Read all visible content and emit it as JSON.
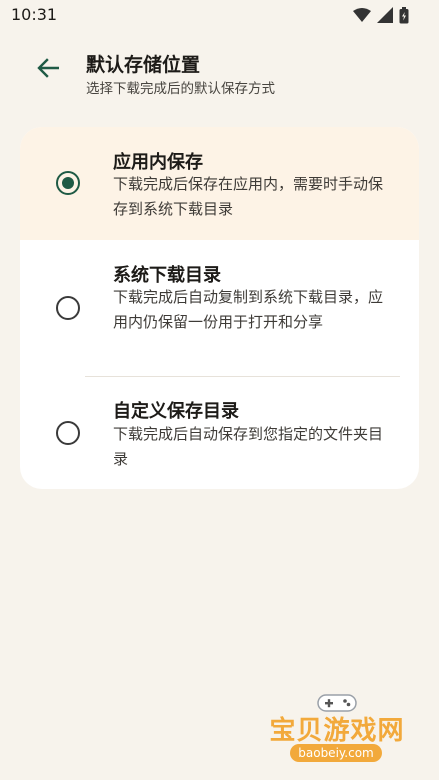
{
  "status_bar": {
    "time": "10:31"
  },
  "header": {
    "title": "默认存储位置",
    "subtitle": "选择下载完成后的默认保存方式"
  },
  "options": [
    {
      "title": "应用内保存",
      "description": "下载完成后保存在应用内，需要时手动保存到系统下载目录",
      "selected": true
    },
    {
      "title": "系统下载目录",
      "description": "下载完成后自动复制到系统下载目录，应用内仍保留一份用于打开和分享",
      "selected": false
    },
    {
      "title": "自定义保存目录",
      "description": "下载完成后自动保存到您指定的文件夹目录",
      "selected": false
    }
  ],
  "watermark": {
    "text": "宝贝游戏网",
    "url": "baobeiy.com"
  },
  "colors": {
    "background": "#f7f3ec",
    "accent": "#1f5a45",
    "selected_background": "#fdf3e6",
    "watermark": "#f2a93b"
  },
  "icons": {
    "back": "arrow-left-icon",
    "wifi": "wifi-icon",
    "signal": "signal-icon",
    "battery": "battery-icon"
  }
}
